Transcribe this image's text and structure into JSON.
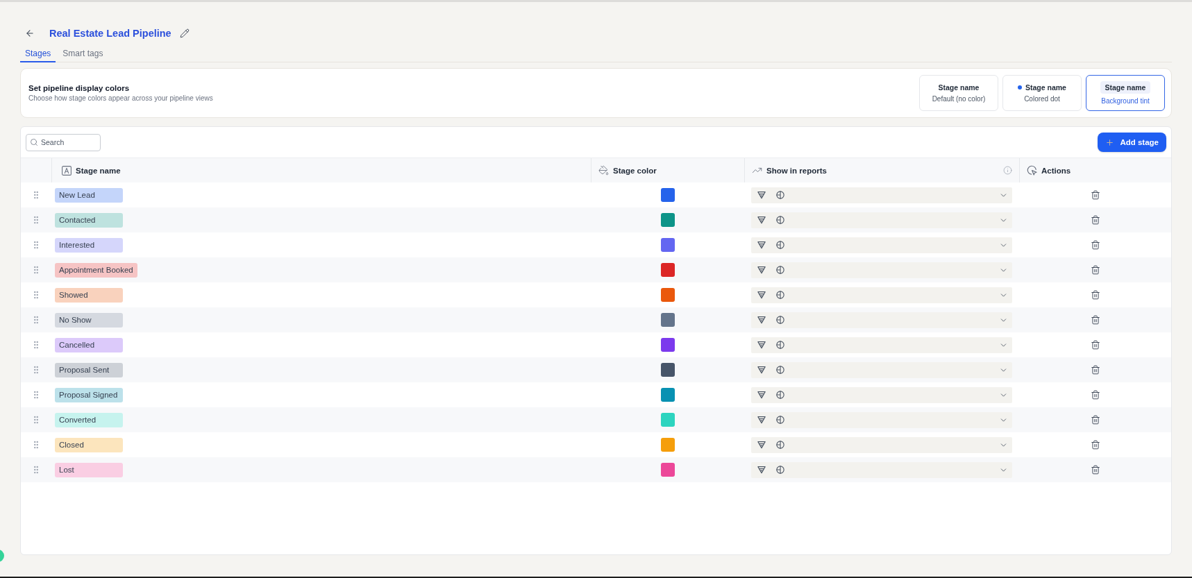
{
  "header": {
    "title": "Real Estate Lead Pipeline"
  },
  "tabs": [
    {
      "label": "Stages",
      "selected": true
    },
    {
      "label": "Smart tags",
      "selected": false
    }
  ],
  "display_colors": {
    "title": "Set pipeline display colors",
    "subtitle": "Choose how stage colors appear across your pipeline views",
    "options": [
      {
        "kind": "plain",
        "label": "Stage name",
        "caption": "Default (no color)",
        "selected": false
      },
      {
        "kind": "dot",
        "label": "Stage name",
        "caption": "Colored dot",
        "selected": false
      },
      {
        "kind": "tint",
        "label": "Stage name",
        "caption": "Background tint",
        "selected": true
      }
    ]
  },
  "toolbar": {
    "search": {
      "placeholder": "Search"
    },
    "add_button": "Add stage"
  },
  "table": {
    "columns": [
      {
        "kind": "name",
        "label": "Stage name"
      },
      {
        "kind": "color",
        "label": "Stage color"
      },
      {
        "kind": "reports",
        "label": "Show in reports"
      },
      {
        "kind": "actions",
        "label": "Actions"
      }
    ],
    "rows": [
      {
        "name": "New Lead",
        "color": "#2563eb"
      },
      {
        "name": "Contacted",
        "color": "#0d9488"
      },
      {
        "name": "Interested",
        "color": "#6366f1"
      },
      {
        "name": "Appointment Booked",
        "color": "#dc2626"
      },
      {
        "name": "Showed",
        "color": "#ea580c"
      },
      {
        "name": "No Show",
        "color": "#64748b"
      },
      {
        "name": "Cancelled",
        "color": "#7c3aed"
      },
      {
        "name": "Proposal Sent",
        "color": "#475569"
      },
      {
        "name": "Proposal Signed",
        "color": "#0891b2"
      },
      {
        "name": "Converted",
        "color": "#2dd4bf"
      },
      {
        "name": "Closed",
        "color": "#f59e0b"
      },
      {
        "name": "Lost",
        "color": "#ec4899"
      }
    ]
  }
}
